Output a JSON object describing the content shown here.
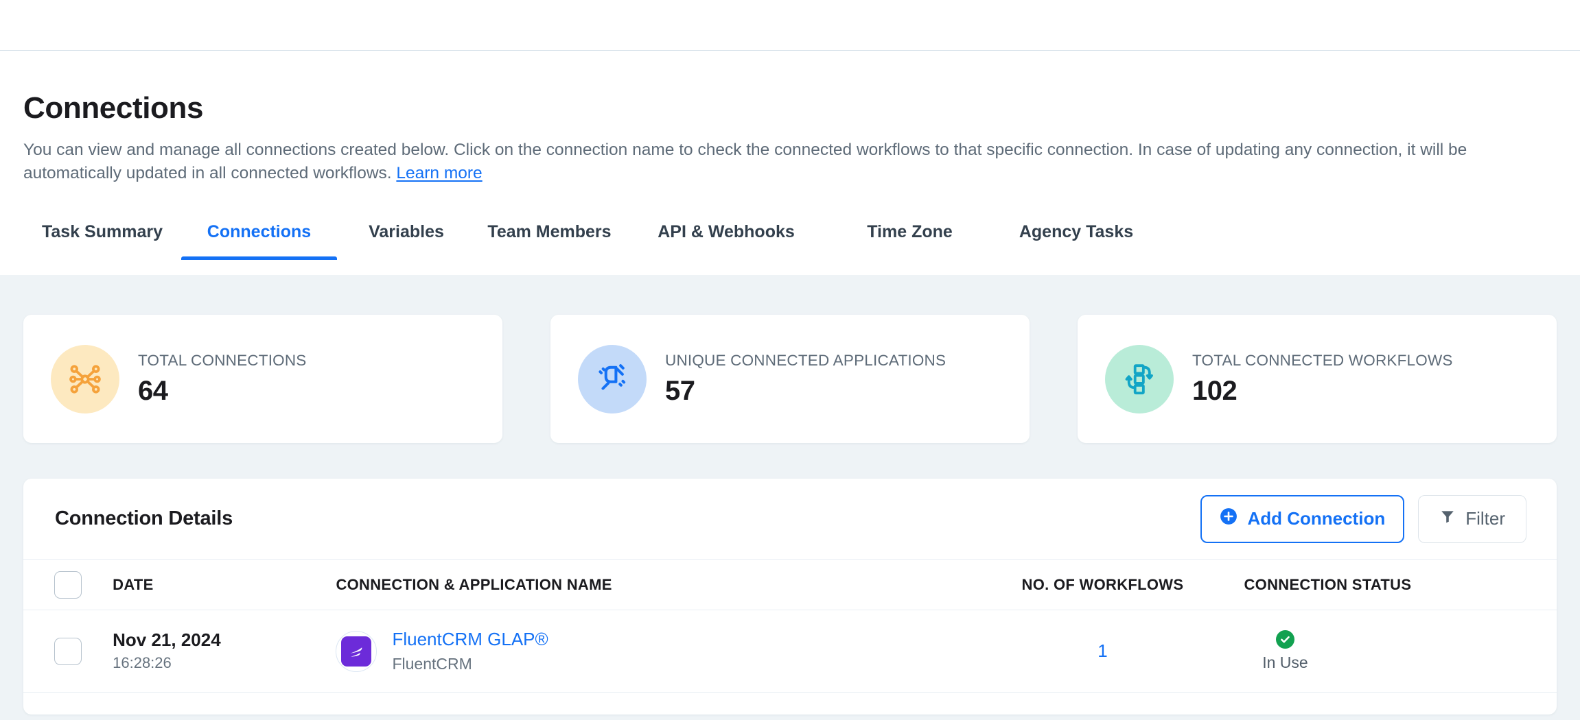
{
  "page": {
    "title": "Connections",
    "description_before_link": "You can view and manage all connections created below. Click on the connection name to check the connected workflows to that specific connection. In case of updating any connection, it will be automatically updated in all connected workflows. ",
    "learn_more_label": "Learn more"
  },
  "tabs": [
    {
      "label": "Task Summary",
      "active": false
    },
    {
      "label": "Connections",
      "active": true
    },
    {
      "label": "Variables",
      "active": false
    },
    {
      "label": "Team Members",
      "active": false
    },
    {
      "label": "API & Webhooks",
      "active": false
    },
    {
      "label": "Time Zone",
      "active": false
    },
    {
      "label": "Agency Tasks",
      "active": false
    }
  ],
  "stats": [
    {
      "label": "TOTAL CONNECTIONS",
      "value": "64",
      "icon": "network-hub-icon",
      "accent": "#f5a23b",
      "bg": "#fde9c0"
    },
    {
      "label": "UNIQUE CONNECTED APPLICATIONS",
      "value": "57",
      "icon": "plug-connector-icon",
      "accent": "#1471f5",
      "bg": "#c3daf9"
    },
    {
      "label": "TOTAL CONNECTED WORKFLOWS",
      "value": "102",
      "icon": "workflow-icon",
      "accent": "#12a5c6",
      "bg": "#b9ecd8"
    }
  ],
  "details": {
    "title": "Connection Details",
    "add_connection_label": "Add Connection",
    "filter_label": "Filter",
    "columns": [
      "DATE",
      "CONNECTION & APPLICATION NAME",
      "NO. OF WORKFLOWS",
      "CONNECTION STATUS"
    ],
    "rows": [
      {
        "date": "Nov 21, 2024",
        "time": "16:28:26",
        "connection_name": "FluentCRM GLAP®",
        "application_name": "FluentCRM",
        "app_logo_color": "#6c2bd9",
        "workflows": "1",
        "status": "In Use",
        "status_color": "#12a150"
      }
    ]
  },
  "colors": {
    "accent_blue": "#1471f5",
    "body_bg": "#eef3f6",
    "text_dark": "#1b1b1f",
    "text_muted": "#5e6b78"
  }
}
